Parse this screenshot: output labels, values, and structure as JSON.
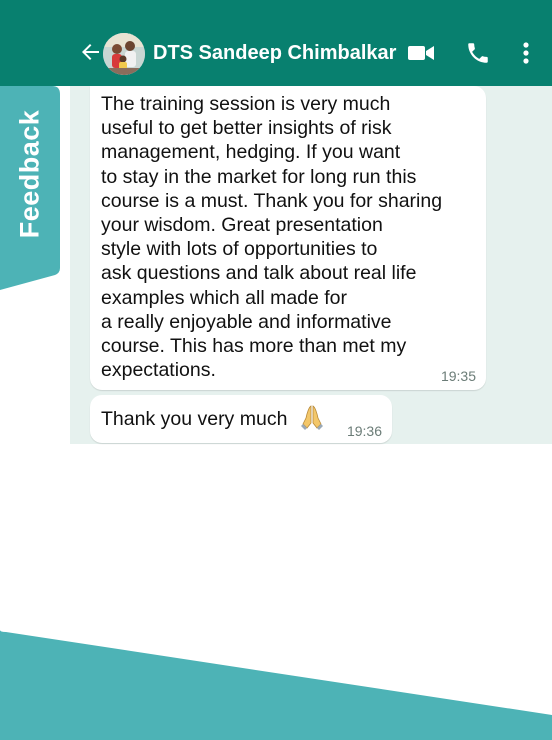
{
  "header": {
    "contact_name": "DTS Sandeep Chimbalkar",
    "icons": [
      "back-arrow-icon",
      "video-call-icon",
      "phone-icon",
      "more-vert-icon"
    ]
  },
  "messages": [
    {
      "text": "The training session is very much\nuseful to get better insights of risk\nmanagement, hedging. If you want\nto stay in the market for long run this\ncourse is a must. Thank you for sharing\nyour wisdom.  Great presentation\nstyle with lots of opportunities to\nask questions and talk about real life\nexamples which all made for\na really enjoyable and informative\ncourse. This has more than met my\nexpectations.",
      "time": "19:35"
    },
    {
      "text": "Thank you very much",
      "emoji": "folded-hands-icon",
      "time": "19:36"
    }
  ],
  "feedback_tab": {
    "label": "Feedback"
  },
  "colors": {
    "header": "#08806f",
    "chat_background": "#e6f1ee",
    "bubble": "#ffffff",
    "feedback_tab": "#4db3b6"
  }
}
